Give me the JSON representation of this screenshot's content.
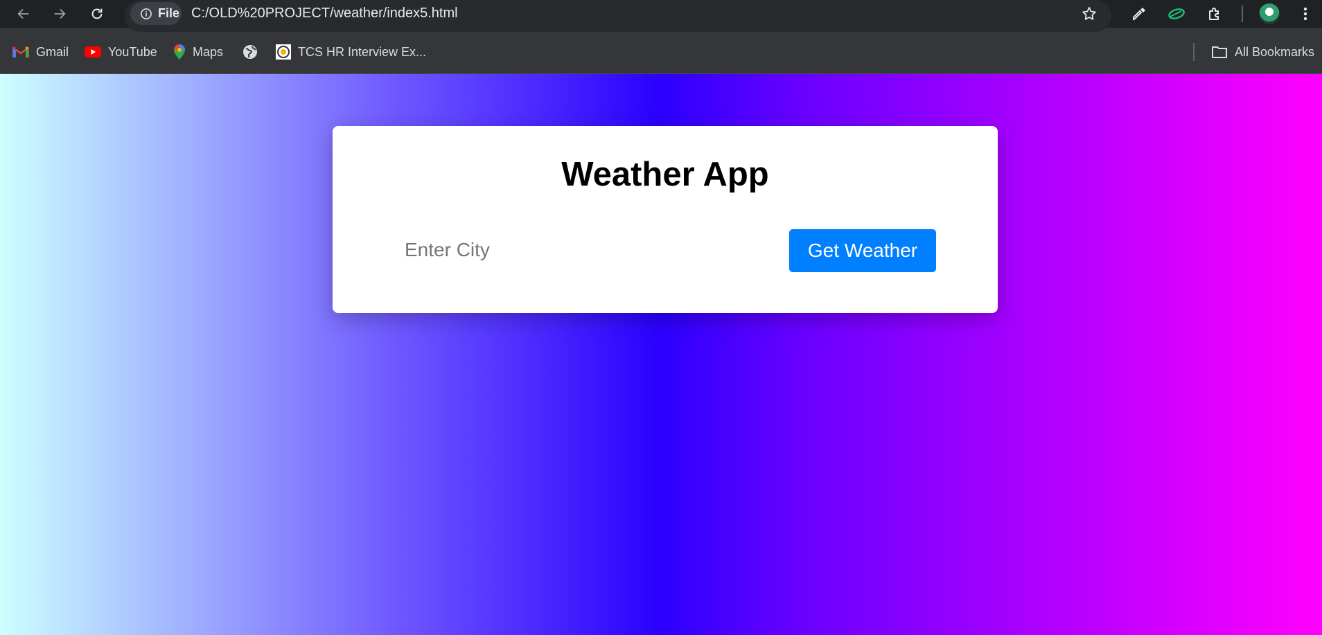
{
  "browser": {
    "file_chip": "File",
    "url": "C:/OLD%20PROJECT/weather/index5.html",
    "bookmarks": [
      {
        "label": "Gmail",
        "icon": "gmail-icon"
      },
      {
        "label": "YouTube",
        "icon": "youtube-icon"
      },
      {
        "label": "Maps",
        "icon": "maps-icon"
      },
      {
        "label": "",
        "icon": "globe-icon"
      },
      {
        "label": "TCS HR Interview Ex...",
        "icon": "site-favicon-icon"
      }
    ],
    "all_bookmarks": "All Bookmarks"
  },
  "app": {
    "title": "Weather App",
    "city_placeholder": "Enter City",
    "city_value": "",
    "button_label": "Get Weather",
    "colors": {
      "button": "#0080ff",
      "gradient": [
        "#ccffff",
        "#2b00ff",
        "#ff00ff"
      ]
    }
  }
}
